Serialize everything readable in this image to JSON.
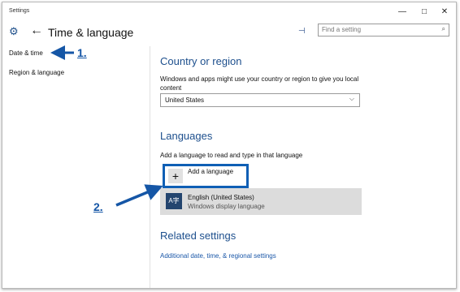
{
  "window": {
    "title": "Settings",
    "controls": {
      "minimize": "—",
      "maximize": "□",
      "close": "✕"
    }
  },
  "header": {
    "title": "Time & language",
    "search_placeholder": "Find a setting"
  },
  "sidebar": {
    "items": [
      {
        "label": "Date & time"
      },
      {
        "label": "Region & language"
      }
    ]
  },
  "content": {
    "country_section": {
      "title": "Country or region",
      "description": "Windows and apps might use your country or region to give you local content",
      "selected": "United States"
    },
    "languages_section": {
      "title": "Languages",
      "description": "Add a language to read and type in that language",
      "add_label": "Add a language",
      "items": [
        {
          "name": "English (United States)",
          "detail": "Windows display language"
        }
      ]
    },
    "related": {
      "title": "Related settings",
      "link": "Additional date, time, & regional settings"
    }
  },
  "annotations": {
    "step1": "1.",
    "step2": "2."
  },
  "colors": {
    "accent": "#1d4f8d",
    "annotation": "#1556a6",
    "link": "#1a57a8"
  },
  "icons": {
    "back": "back-arrow-icon",
    "pin": "pin-icon",
    "search": "search-icon",
    "plus": "plus-icon",
    "language": "language-icon"
  }
}
